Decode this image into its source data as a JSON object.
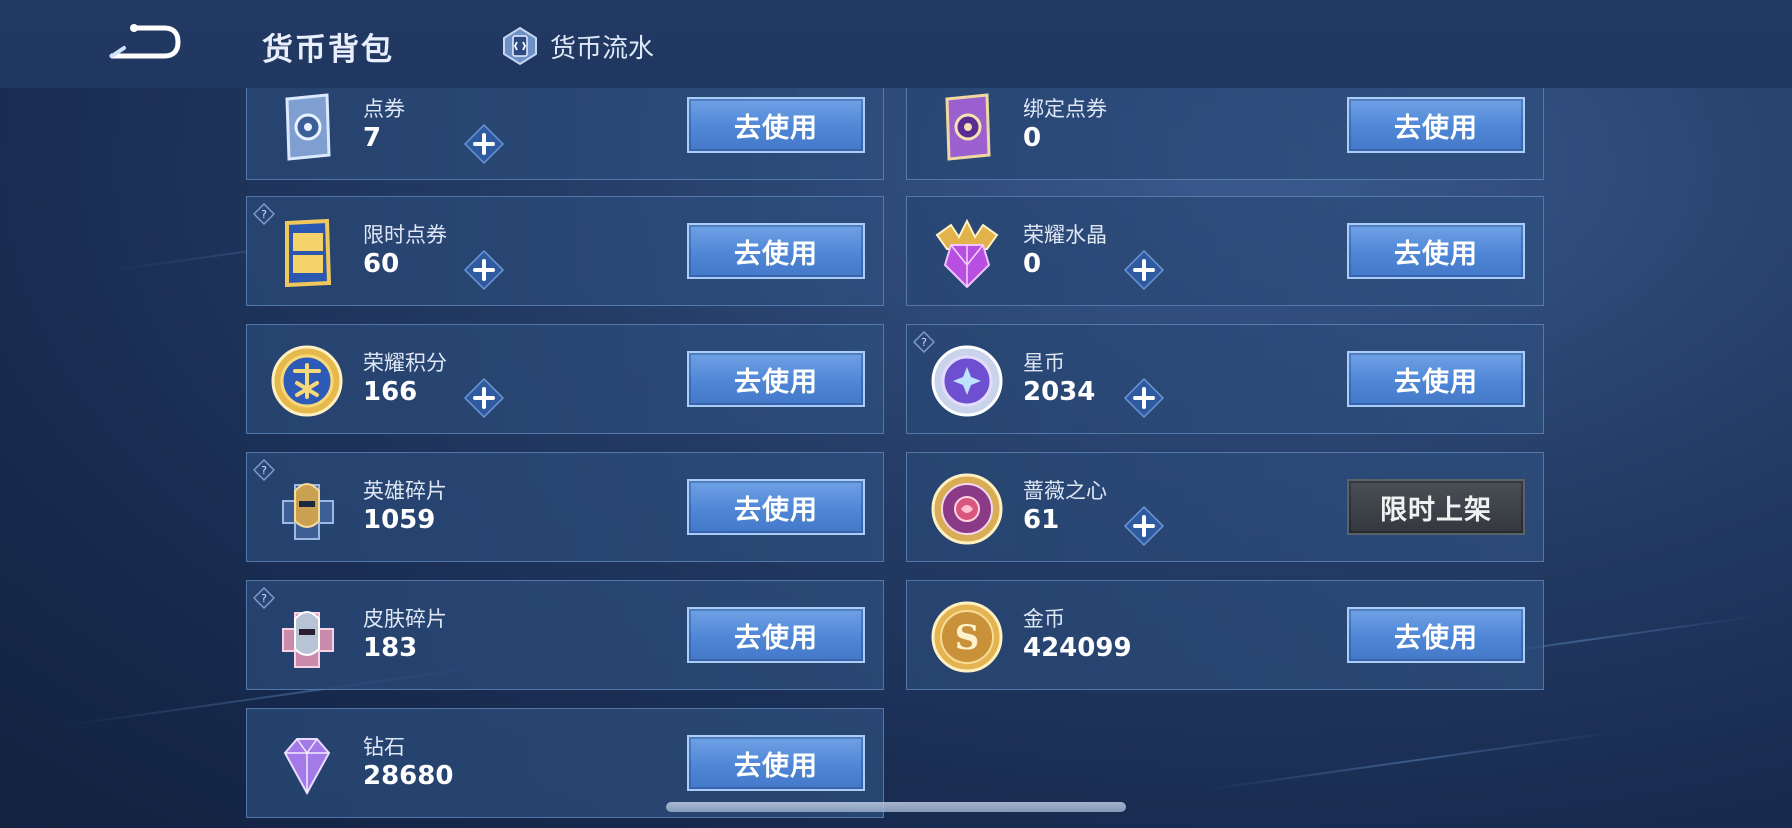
{
  "header": {
    "title": "货币背包",
    "flow_label": "货币流水"
  },
  "colors": {
    "button_blue": "#4f86d6",
    "button_gray": "#3a3e44",
    "background": "#243c66"
  },
  "currencies": [
    {
      "name": "点券",
      "value": "7",
      "icon": "voucher-icon",
      "button": "去使用"
    },
    {
      "name": "绑定点券",
      "value": "0",
      "icon": "bound-voucher-icon",
      "button": "去使用"
    },
    {
      "name": "限时点券",
      "value": "60",
      "icon": "limited-voucher-icon",
      "button": "去使用"
    },
    {
      "name": "荣耀水晶",
      "value": "0",
      "icon": "glory-crystal-icon",
      "button": "去使用"
    },
    {
      "name": "荣耀积分",
      "value": "166",
      "icon": "glory-points-icon",
      "button": "去使用"
    },
    {
      "name": "星币",
      "value": "2034",
      "icon": "star-coin-icon",
      "button": "去使用"
    },
    {
      "name": "英雄碎片",
      "value": "1059",
      "icon": "hero-fragment-icon",
      "button": "去使用"
    },
    {
      "name": "蔷薇之心",
      "value": "61",
      "icon": "rose-heart-icon",
      "button": "限时上架"
    },
    {
      "name": "皮肤碎片",
      "value": "183",
      "icon": "skin-fragment-icon",
      "button": "去使用"
    },
    {
      "name": "金币",
      "value": "424099",
      "icon": "gold-coin-icon",
      "button": "去使用"
    },
    {
      "name": "钻石",
      "value": "28680",
      "icon": "diamond-icon",
      "button": "去使用"
    }
  ]
}
